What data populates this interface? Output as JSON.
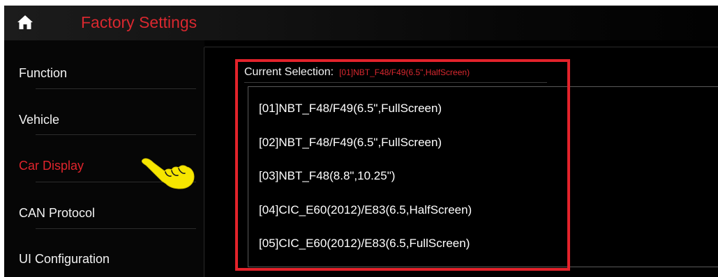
{
  "header": {
    "title": "Factory Settings",
    "home_icon": "home-icon"
  },
  "sidebar": {
    "items": [
      {
        "label": "Function",
        "active": false
      },
      {
        "label": "Vehicle",
        "active": false
      },
      {
        "label": "Car Display",
        "active": true
      },
      {
        "label": "CAN Protocol",
        "active": false
      },
      {
        "label": "UI Configuration",
        "active": false
      }
    ],
    "pointer_icon": "pointing-hand-icon"
  },
  "main": {
    "current_selection_label": "Current Selection:",
    "current_selection_value": "[01]NBT_F48/F49(6.5\",HalfScreen)",
    "options": [
      "[01]NBT_F48/F49(6.5\",FullScreen)",
      "[02]NBT_F48/F49(6.5\",FullScreen)",
      "[03]NBT_F48(8.8\",10.25\")",
      "[04]CIC_E60(2012)/E83(6.5,HalfScreen)",
      "[05]CIC_E60(2012)/E83(6.5,FullScreen)"
    ]
  },
  "colors": {
    "accent": "#e0242c",
    "highlight_frame": "#e3232b",
    "hand": "#f7e600",
    "background": "#000000",
    "text": "#ffffff"
  }
}
